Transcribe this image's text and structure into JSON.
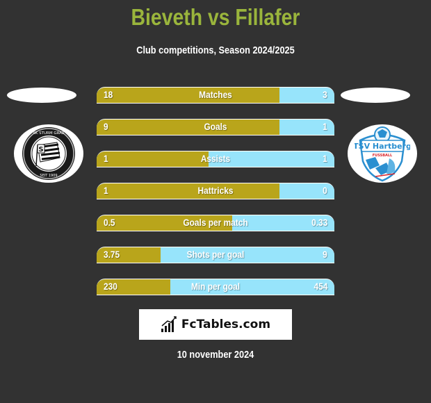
{
  "header": {
    "title": "Bieveth vs Fillafer",
    "subtitle": "Club competitions, Season 2024/2025"
  },
  "teams": {
    "left": {
      "name": "Bieveth",
      "logo": "sk-sturm-graz-crest-icon",
      "logo_text_top": "SK STURM GRAZ",
      "logo_text_bottom": "SEIT 1909"
    },
    "right": {
      "name": "Fillafer",
      "logo": "tsv-hartberg-crest-icon",
      "logo_text": "TSV Hartberg",
      "logo_subtext": "FUSSBALL"
    }
  },
  "colors": {
    "left_bar": "#b9a51b",
    "right_bar": "#97e4fb",
    "title": "#9ab53c",
    "background": "#323232"
  },
  "stats": [
    {
      "label": "Matches",
      "left": "18",
      "right": "3",
      "left_share": 0.77
    },
    {
      "label": "Goals",
      "left": "9",
      "right": "1",
      "left_share": 0.77
    },
    {
      "label": "Assists",
      "left": "1",
      "right": "1",
      "left_share": 0.47
    },
    {
      "label": "Hattricks",
      "left": "1",
      "right": "0",
      "left_share": 0.77
    },
    {
      "label": "Goals per match",
      "left": "0.5",
      "right": "0.33",
      "left_share": 0.57
    },
    {
      "label": "Shots per goal",
      "left": "3.75",
      "right": "9",
      "left_share": 0.27
    },
    {
      "label": "Min per goal",
      "left": "230",
      "right": "454",
      "left_share": 0.31
    }
  ],
  "footer": {
    "brand": "FcTables.com",
    "brand_icon": "bar-chart-icon",
    "date": "10 november 2024"
  }
}
